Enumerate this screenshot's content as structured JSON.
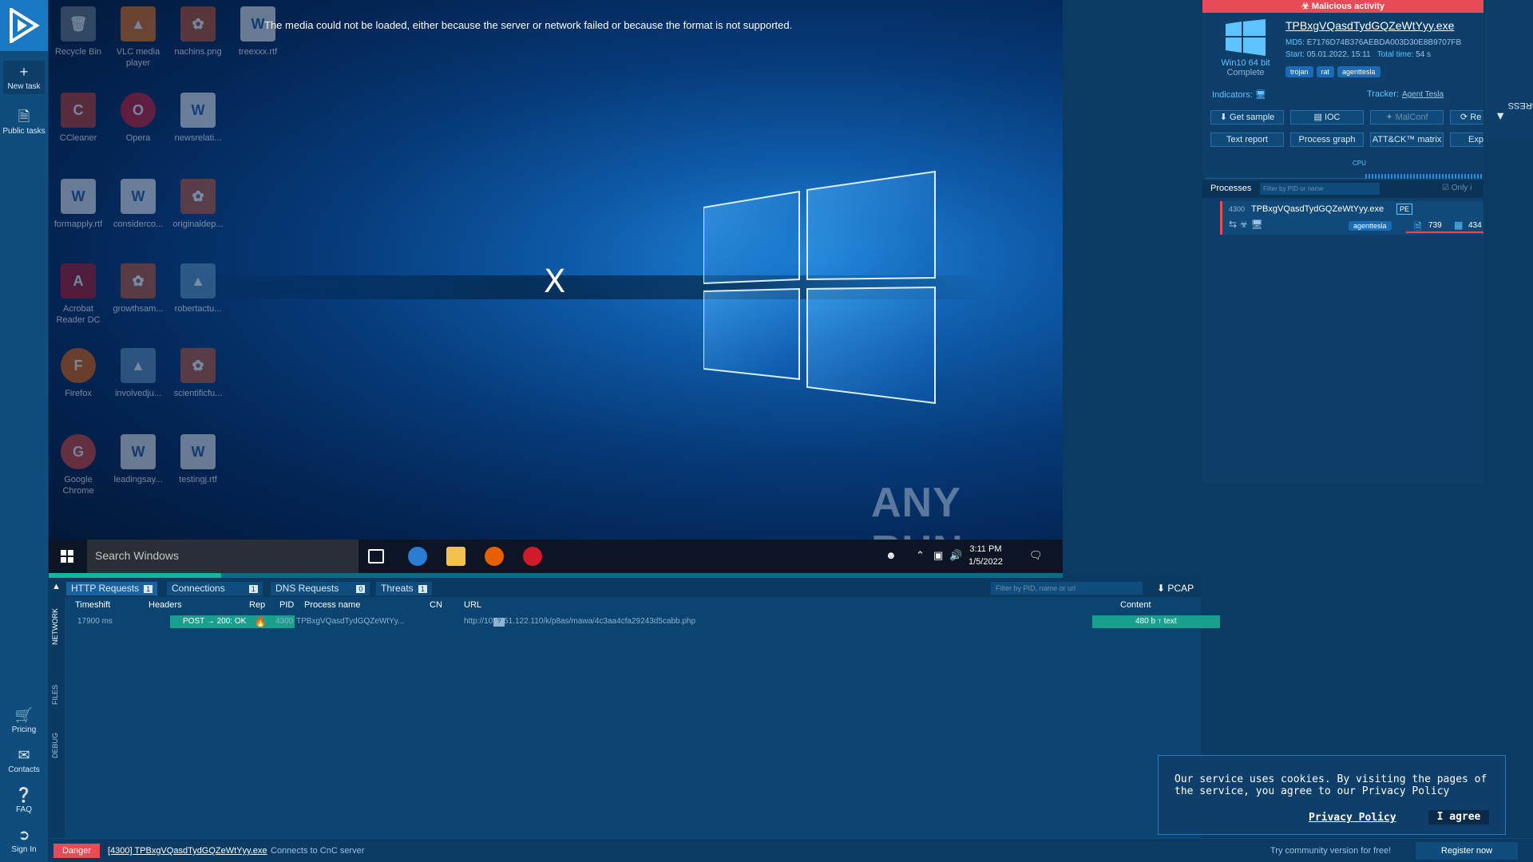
{
  "sidebar": {
    "new_task": "New task",
    "public_tasks": "Public tasks",
    "pricing": "Pricing",
    "contacts": "Contacts",
    "faq": "FAQ",
    "sign_in": "Sign In"
  },
  "vm": {
    "media_error": "The media could not be loaded, either because the server or network failed or because the format is not supported.",
    "close_glyph": "X",
    "watermark": "ANY RUN",
    "desktop_icons": [
      {
        "label": "Recycle Bin"
      },
      {
        "label": "VLC media player"
      },
      {
        "label": "nachins.png"
      },
      {
        "label": "treexxx.rtf"
      },
      {
        "label": "CCleaner"
      },
      {
        "label": "Opera"
      },
      {
        "label": "newsrelati..."
      },
      {
        "label": "formapply.rtf"
      },
      {
        "label": "considerco..."
      },
      {
        "label": "originaldep..."
      },
      {
        "label": "Acrobat Reader DC"
      },
      {
        "label": "growthsam..."
      },
      {
        "label": "robertactu..."
      },
      {
        "label": "Firefox"
      },
      {
        "label": "involvedju..."
      },
      {
        "label": "scientificfu..."
      },
      {
        "label": "Google Chrome"
      },
      {
        "label": "leadingsay..."
      },
      {
        "label": "testingj.rtf"
      }
    ],
    "taskbar": {
      "search_placeholder": "Search Windows",
      "time": "3:11 PM",
      "date": "1/5/2022"
    },
    "progress": 0.17
  },
  "info": {
    "banner": "Malicious activity",
    "os": "Win10 64 bit",
    "os_status": "Complete",
    "process_name": "TPBxgVQasdTydGQZeWtYyy.exe",
    "md5_label": "MD5:",
    "md5": "E7176D74B376AEBDA003D30E8B9707FB",
    "start_label": "Start:",
    "start": "05.01.2022, 15:11",
    "total_label": "Total time:",
    "total": "54 s",
    "tags": [
      "trojan",
      "rat",
      "agenttesla"
    ],
    "indicators_label": "Indicators:",
    "tracker_label": "Tracker:",
    "tracker": "Agent Tesla",
    "buttons_row1": [
      "Get sample",
      "IOC",
      "MalConf",
      "Re"
    ],
    "buttons_row2": [
      "Text report",
      "Process graph",
      "ATT&CK™ matrix",
      "Expo"
    ],
    "cpu_label": "CPU",
    "processes_label": "Processes",
    "filter_placeholder": "Filter by PID or name",
    "only_label": "Only i",
    "process": {
      "pid": "4300",
      "name": "TPBxgVQasdTydGQZeWtYyy.exe",
      "badge": "PE",
      "tag": "agenttesla",
      "count1": "739",
      "count2": "434"
    }
  },
  "side_tab": "PROCESS IN PROGRESS",
  "network": {
    "tabs": [
      {
        "label": "HTTP Requests",
        "count": "1"
      },
      {
        "label": "Connections",
        "count": "1"
      },
      {
        "label": "DNS Requests",
        "count": "0"
      },
      {
        "label": "Threats",
        "count": "1"
      }
    ],
    "filter_placeholder": "Filter by PID, name or url",
    "pcap": "PCAP",
    "side_tabs": [
      "NETWORK",
      "FILES",
      "DEBUG"
    ],
    "columns": [
      "Timeshift",
      "Headers",
      "Rep",
      "PID",
      "Process name",
      "CN",
      "URL",
      "Content"
    ],
    "row": {
      "timeshift": "17900 ms",
      "headers": "POST → 200: OK",
      "pid": "4300",
      "process": "TPBxgVQasdTydGQZeWtYy...",
      "cn": "?",
      "url": "http://103.151.122.110/k/p8as/mawa/4c3aa4cfa29243d5cabb.php",
      "content": "480 b  ↑ text"
    }
  },
  "cookie": {
    "text": "Our service uses cookies. By visiting the pages of the service, you agree to our Privacy Policy",
    "link": "Privacy Policy",
    "agree": "I agree"
  },
  "status": {
    "level": "Danger",
    "process": "[4300] TPBxgVQasdTydGQZeWtYyy.exe",
    "message": "Connects to CnC server",
    "try": "Try community version for free!",
    "register": "Register now"
  }
}
